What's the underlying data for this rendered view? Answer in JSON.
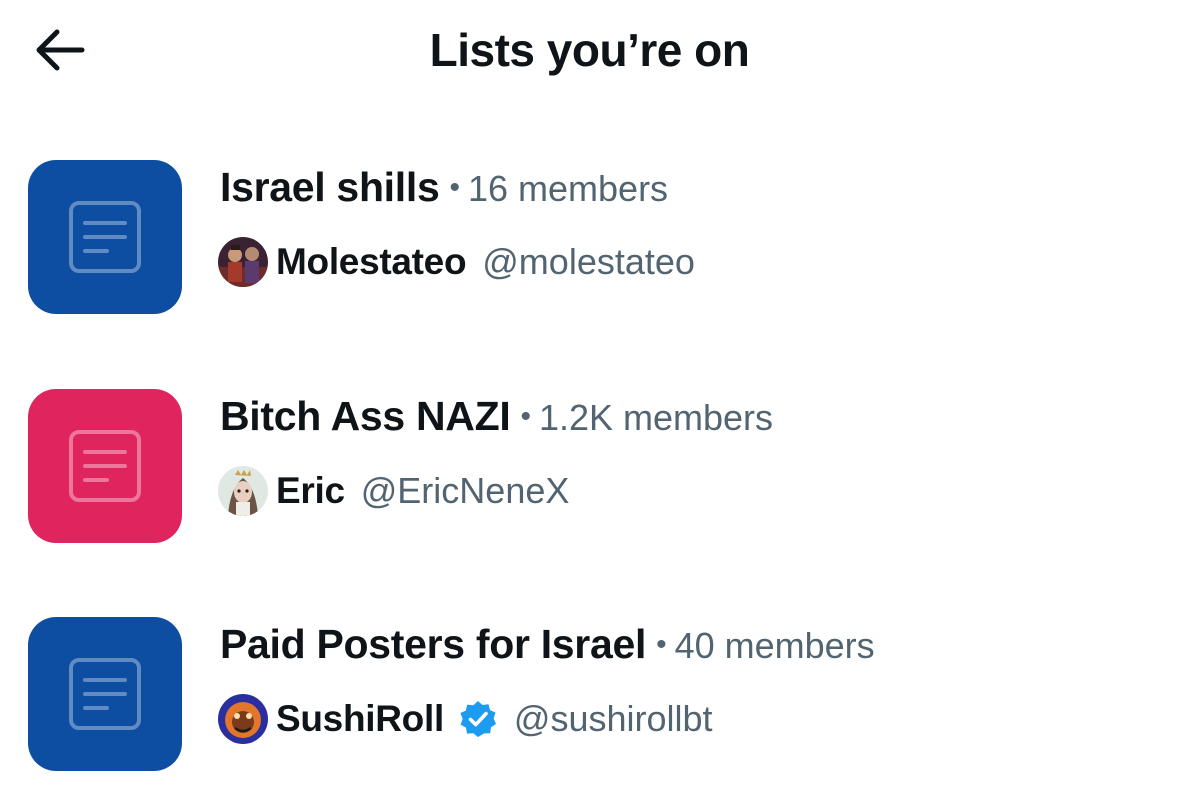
{
  "header": {
    "back_icon": "arrow-left-icon",
    "title": "Lists you’re on"
  },
  "colors": {
    "text_primary": "#0f1419",
    "text_secondary": "#536471",
    "tile_blue": "#0d4ea3",
    "tile_pink": "#e0245e",
    "verified_blue": "#1d9bf0"
  },
  "separator": "•",
  "lists": [
    {
      "name": "Israel shills",
      "members": "16 members",
      "tile_color": "#0d4ea3",
      "tile_icon": "list-document-icon",
      "owner": {
        "name": "Molestateo",
        "handle": "@molestateo",
        "verified": false
      }
    },
    {
      "name": "Bitch Ass NAZI",
      "members": "1.2K members",
      "tile_color": "#e0245e",
      "tile_icon": "list-document-icon",
      "owner": {
        "name": "Eric",
        "handle": "@EricNeneX",
        "verified": false
      }
    },
    {
      "name": "Paid Posters for Israel",
      "members": "40 members",
      "tile_color": "#0d4ea3",
      "tile_icon": "list-document-icon",
      "owner": {
        "name": "SushiRoll",
        "handle": "@sushirollbt",
        "verified": true,
        "verified_icon": "verified-badge-icon"
      }
    }
  ]
}
